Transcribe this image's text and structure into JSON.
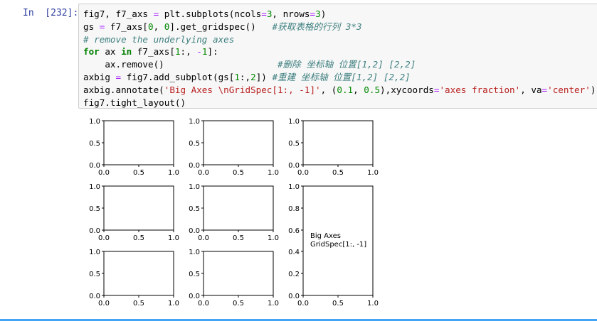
{
  "cell": {
    "prompt": "In  [232]:",
    "code_lines": [
      [
        {
          "t": "fig7, f7_axs "
        },
        {
          "t": "=",
          "c": "op"
        },
        {
          "t": " plt.subplots(ncols"
        },
        {
          "t": "=",
          "c": "op"
        },
        {
          "t": "3",
          "c": "num"
        },
        {
          "t": ", nrows"
        },
        {
          "t": "=",
          "c": "op"
        },
        {
          "t": "3",
          "c": "num"
        },
        {
          "t": ")"
        }
      ],
      [
        {
          "t": "gs "
        },
        {
          "t": "=",
          "c": "op"
        },
        {
          "t": " f7_axs["
        },
        {
          "t": "0",
          "c": "num"
        },
        {
          "t": ", "
        },
        {
          "t": "0",
          "c": "num"
        },
        {
          "t": "].get_gridspec()   "
        },
        {
          "t": "#获取表格的行列 3*3",
          "c": "cm"
        }
      ],
      [
        {
          "t": "# remove the underlying axes",
          "c": "cm"
        }
      ],
      [
        {
          "t": "for",
          "c": "kw"
        },
        {
          "t": " ax "
        },
        {
          "t": "in",
          "c": "kw"
        },
        {
          "t": " f7_axs["
        },
        {
          "t": "1",
          "c": "num"
        },
        {
          "t": ":, "
        },
        {
          "t": "-",
          "c": "op"
        },
        {
          "t": "1",
          "c": "num"
        },
        {
          "t": "]:"
        }
      ],
      [
        {
          "t": "    ax.remove()                     "
        },
        {
          "t": "#删除 坐标轴 位置[1,2] [2,2]",
          "c": "cm"
        }
      ],
      [
        {
          "t": "axbig "
        },
        {
          "t": "=",
          "c": "op"
        },
        {
          "t": " fig7.add_subplot(gs["
        },
        {
          "t": "1",
          "c": "num"
        },
        {
          "t": ":,"
        },
        {
          "t": "2",
          "c": "num"
        },
        {
          "t": "]) "
        },
        {
          "t": "#重建 坐标轴 位置[1,2] [2,2]",
          "c": "cm"
        }
      ],
      [
        {
          "t": "axbig.annotate("
        },
        {
          "t": "'Big Axes \\nGridSpec[1:, -1]'",
          "c": "str"
        },
        {
          "t": ", ("
        },
        {
          "t": "0.1",
          "c": "num"
        },
        {
          "t": ", "
        },
        {
          "t": "0.5",
          "c": "num"
        },
        {
          "t": "),xycoords"
        },
        {
          "t": "=",
          "c": "op"
        },
        {
          "t": "'axes fraction'",
          "c": "str"
        },
        {
          "t": ", va"
        },
        {
          "t": "=",
          "c": "op"
        },
        {
          "t": "'center'",
          "c": "str"
        },
        {
          "t": ")"
        }
      ],
      [
        {
          "t": "fig7.tight_layout()"
        }
      ]
    ]
  },
  "figure": {
    "small_axes": [
      {
        "x": [
          "0.0",
          "0.5",
          "1.0"
        ],
        "y": [
          "0.0",
          "0.5",
          "1.0"
        ]
      },
      {
        "x": [
          "0.0",
          "0.5",
          "1.0"
        ],
        "y": [
          "0.0",
          "0.5",
          "1.0"
        ]
      },
      {
        "x": [
          "0.0",
          "0.5",
          "1.0"
        ],
        "y": [
          "0.0",
          "0.5",
          "1.0"
        ]
      },
      {
        "x": [
          "0.0",
          "0.5",
          "1.0"
        ],
        "y": [
          "0.0",
          "0.5",
          "1.0"
        ]
      },
      {
        "x": [
          "0.0",
          "0.5",
          "1.0"
        ],
        "y": [
          "0.0",
          "0.5",
          "1.0"
        ]
      },
      {
        "x": [
          "0.0",
          "0.5",
          "1.0"
        ],
        "y": [
          "0.0",
          "0.5",
          "1.0"
        ]
      },
      {
        "x": [
          "0.0",
          "0.5",
          "1.0"
        ],
        "y": [
          "0.0",
          "0.5",
          "1.0"
        ]
      }
    ],
    "big_axes": {
      "x": [
        "0.0",
        "0.5",
        "1.0"
      ],
      "y": [
        "0.0",
        "0.2",
        "0.4",
        "0.6",
        "0.8",
        "1.0"
      ],
      "annotation_line1": "Big Axes",
      "annotation_line2": "GridSpec[1:, -1]"
    }
  },
  "colors": {
    "prompt": "#303f9f",
    "code_background": "#f7f7f7",
    "keyword": "#008000",
    "comment": "#408080",
    "string": "#ba2121",
    "operator": "#aa22ff",
    "active_cell_bar": "#42a5f5"
  }
}
